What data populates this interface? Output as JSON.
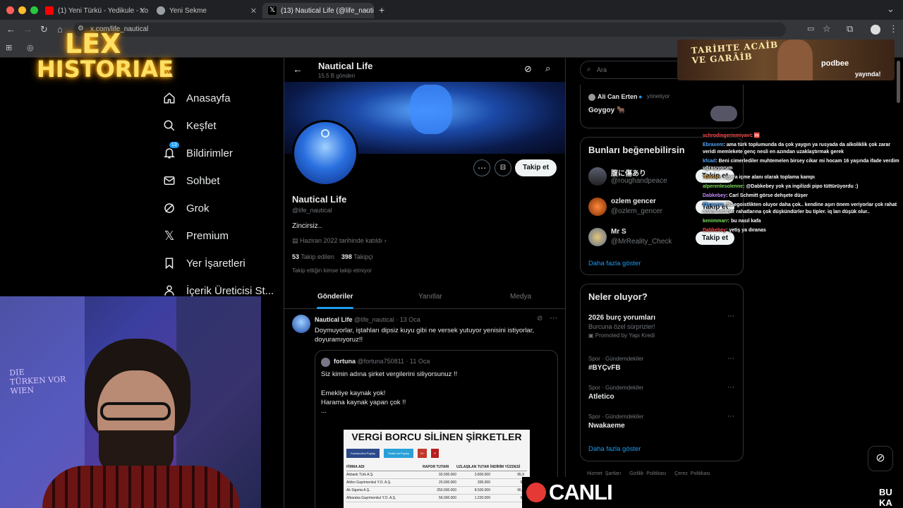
{
  "browser": {
    "tabs": [
      {
        "title": "(1) Yeni Türkü - Yedikule - Yo",
        "fav": "#ff0000"
      },
      {
        "title": "Yeni Sekme",
        "fav": "#9aa0a6"
      },
      {
        "title": "(13) Nautical Life (@life_nauti",
        "fav": "#ffffff"
      }
    ],
    "url": "x.com/life_nautical"
  },
  "overlay": {
    "logo_line1": "LEX",
    "logo_line2": "HISTORIAE",
    "podcast_title": "TARİHTE ACAİB VE GARÂİB",
    "podcast_brand": "podbee",
    "podcast_status": "yayında!",
    "live_label": "CANLI",
    "ticker_text": "BU KA"
  },
  "nav": {
    "notif_count": "13",
    "items": [
      "Anasayfa",
      "Keşfet",
      "Bildirimler",
      "Sohbet",
      "Grok",
      "Premium",
      "Yer İşaretleri",
      "İçerik Üreticisi St..."
    ]
  },
  "profile": {
    "name": "Nautical Life",
    "posts_count": "15,5 B gönderi",
    "handle": "@life_nautical",
    "bio": "Zincirsiz..",
    "joined": "Haziran 2022 tarihinde katıldı",
    "following_num": "53",
    "following_label": "Takip edilen",
    "followers_num": "398",
    "followers_label": "Takipçi",
    "mutuals": "Takip ettiğin kimse takip etmiyor",
    "follow_button": "Takip et",
    "tabs": [
      "Gönderiler",
      "Yanıtlar",
      "Medya"
    ]
  },
  "tweet": {
    "name": "Nautical Life",
    "handle": "@life_nautical",
    "date": "· 13 Oca",
    "text": "Doymuyorlar, iştahları dipsiz kuyu gibi ne versek yutuyor yenisini istiyorlar, doyuramıyoruz!!",
    "quote": {
      "name": "fortuna",
      "handle": "@fortuna750811",
      "date": "· 11 Oca",
      "line1": "Siz kimin adına şirket vergilerini siliyorsunuz !!",
      "line2": "Emekliye kaynak  yok!",
      "line3": "Harama kaynak yapan çok !!",
      "line4": "...",
      "image_title": "VERGİ BORCU SİLİNEN ŞİRKETLER",
      "image_buttons": [
        "Facebook'ta Paylaş",
        "Twitter'da Paylaş",
        "G+",
        "P"
      ],
      "table_headers": [
        "FİRMA ADI",
        "RAPOR TUTARI",
        "UZLAŞILAN TUTAR",
        "İNDİRİM YÜZDESİ"
      ],
      "table_rows": [
        [
          "Akbank Türk A.Ş.",
          "93.000.000",
          "3.800.000",
          "95,9"
        ],
        [
          "Akfen Gayrimenkul Y.O. A.Ş.",
          "20.000.000",
          "395.000",
          "98"
        ],
        [
          "Ak Sigorta A.Ş.",
          "250.000.000",
          "8.500.000",
          "96,6"
        ],
        [
          "Albaraka Gayrimenkul Y.O. A.Ş.",
          "56.000.000",
          "1.220.000",
          "97"
        ]
      ]
    }
  },
  "right": {
    "search_placeholder": "Ara",
    "top_card": {
      "name": "Ali Can Erten",
      "badge": "yönetiyor",
      "text": "Goygoy 🐂"
    },
    "suggest_title": "Bunları beğenebilirsin",
    "suggestions": [
      {
        "name": "腹に傷あり",
        "handle": "@roughandpeace"
      },
      {
        "name": "ozlem gencer",
        "handle": "@ozlem_gencer"
      },
      {
        "name": "Mr S",
        "handle": "@MrReality_Check"
      }
    ],
    "follow_label": "Takip et",
    "more_label": "Daha fazla göster",
    "happening_title": "Neler oluyor?",
    "trends": [
      {
        "cat": "",
        "title": "2026 burç yorumları",
        "sub": "Burcuna özel sürprizler!",
        "promo": "Promoted by Yapı Kredi"
      },
      {
        "cat": "Spor · Gündemdekiler",
        "title": "#BYÇvFB"
      },
      {
        "cat": "Spor · Gündemdekiler",
        "title": "Atletico"
      },
      {
        "cat": "Spor · Gündemdekiler",
        "title": "Nwakaeme"
      }
    ],
    "footer": [
      "Hizmet Şartları",
      "Gizlilik Politikası",
      "Çerez Politikası"
    ]
  },
  "chat": [
    {
      "user": "schrodingerinmiyavi",
      "color": "#ff4d4d",
      "msg": ": 🆘"
    },
    {
      "user": "Ebraxem",
      "color": "#4da6ff",
      "msg": ": ama türk toplumunda da çok yaygın ya rusyada da alkoliklik çok zarar veridi memlekete genç nesli en azından uzaklaştırmak gerek"
    },
    {
      "user": "kfcad",
      "color": "#4da6ff",
      "msg": ": Beni cimerlediler muhtemelen birsey cikar mi hocam 16 yaşında ifade verdim uğraşıyorum"
    },
    {
      "user": "Turkish",
      "color": "#e6a23c",
      "msg": ": sigara içme alanı olarak toplama kampı"
    },
    {
      "user": "alperenlesolenne",
      "color": "#7ddc5e",
      "msg": ": @Dabkebey yok ya ingilizdi pipo tüttürüyordu :)"
    },
    {
      "user": "Dabkebey",
      "color": "#c78bff",
      "msg": ": Carl Schmitt görse dehşete düşer"
    },
    {
      "user": "Ebraxem",
      "color": "#4da6ff",
      "msg": ": bu egoistlikten oluyor daha çok.. kendine aşırı önem veriyorlar çok rahat adam satarlar rahatlarına çok düşkündürler bu tipler. iq ları düşük olur.."
    },
    {
      "user": "kenimmarr",
      "color": "#7ddc5e",
      "msg": ": bu nasıl kafa"
    },
    {
      "user": "Dabkebey",
      "color": "#ff4d4d",
      "msg": ": yetiş ya dıranas"
    }
  ]
}
